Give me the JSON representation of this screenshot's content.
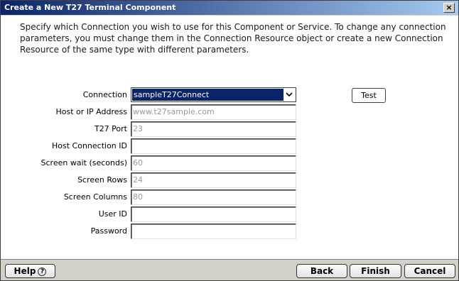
{
  "window": {
    "title": "Create a New T27 Terminal Component",
    "close_glyph": "×"
  },
  "description": "Specify which Connection you wish to use for this Component or Service.  To change any connection parameters, you must change them in the Connection Resource object or create a new Connection Resource of the same type with different parameters.",
  "form": {
    "connection": {
      "label": "Connection",
      "value": "sampleT27Connect"
    },
    "host": {
      "label": "Host or IP Address",
      "value": "www.t27sample.com"
    },
    "port": {
      "label": "T27 Port",
      "value": "23"
    },
    "host_conn_id": {
      "label": "Host Connection ID",
      "value": ""
    },
    "screen_wait": {
      "label": "Screen wait (seconds)",
      "value": "60"
    },
    "screen_rows": {
      "label": "Screen Rows",
      "value": "24"
    },
    "screen_cols": {
      "label": "Screen Columns",
      "value": "80"
    },
    "user_id": {
      "label": "User ID",
      "value": ""
    },
    "password": {
      "label": "Password",
      "value": ""
    }
  },
  "buttons": {
    "test": "Test",
    "help": "Help",
    "help_icon": "?",
    "back": "Back",
    "finish": "Finish",
    "cancel": "Cancel"
  }
}
